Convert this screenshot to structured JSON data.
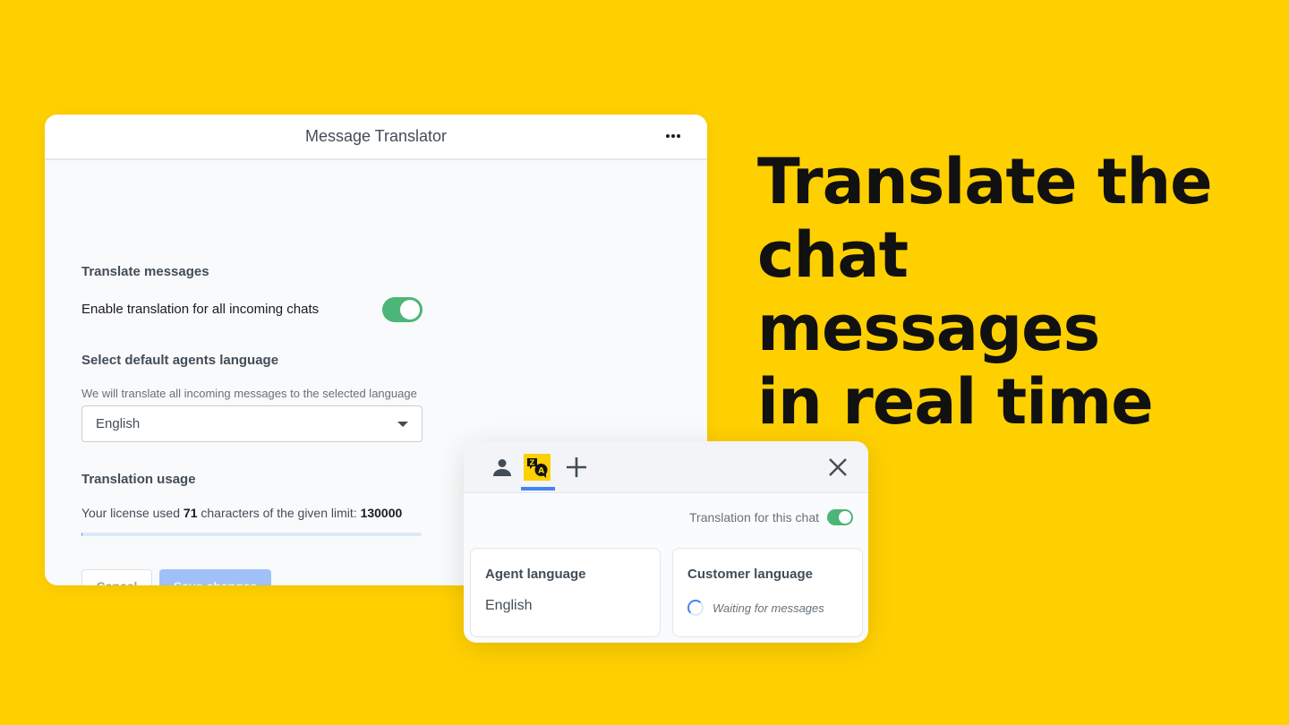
{
  "settings": {
    "title": "Message Translator",
    "more_icon": "more-horizontal-icon",
    "translate_section": {
      "title": "Translate messages",
      "toggle_label": "Enable translation for all incoming chats",
      "toggle_on": true
    },
    "language_section": {
      "title": "Select default agents language",
      "hint": "We will translate all incoming messages to the selected language",
      "selected": "English"
    },
    "usage_section": {
      "title": "Translation usage",
      "text_prefix": "Your license used ",
      "used": "71",
      "text_middle": " characters of the given limit: ",
      "limit": "130000",
      "progress_fraction": 0.0005
    },
    "cancel_label": "Cancel",
    "save_label": "Save changes"
  },
  "chat": {
    "tabs": [
      {
        "name": "customer-details",
        "icon": "person-icon"
      },
      {
        "name": "translator",
        "icon": "translate-icon",
        "active": true
      },
      {
        "name": "add",
        "icon": "plus-icon"
      }
    ],
    "close_icon": "close-icon",
    "translation_toggle_label": "Translation for this chat",
    "translation_toggle_on": true,
    "agent_card": {
      "title": "Agent language",
      "value": "English"
    },
    "customer_card": {
      "title": "Customer language",
      "status": "Waiting for messages"
    }
  },
  "headline": {
    "line1": "Translate the",
    "line2": "chat messages",
    "line3": "in real time"
  },
  "colors": {
    "background": "#FFD000",
    "toggle_green": "#4bb678",
    "accent_blue": "#4384f5"
  }
}
